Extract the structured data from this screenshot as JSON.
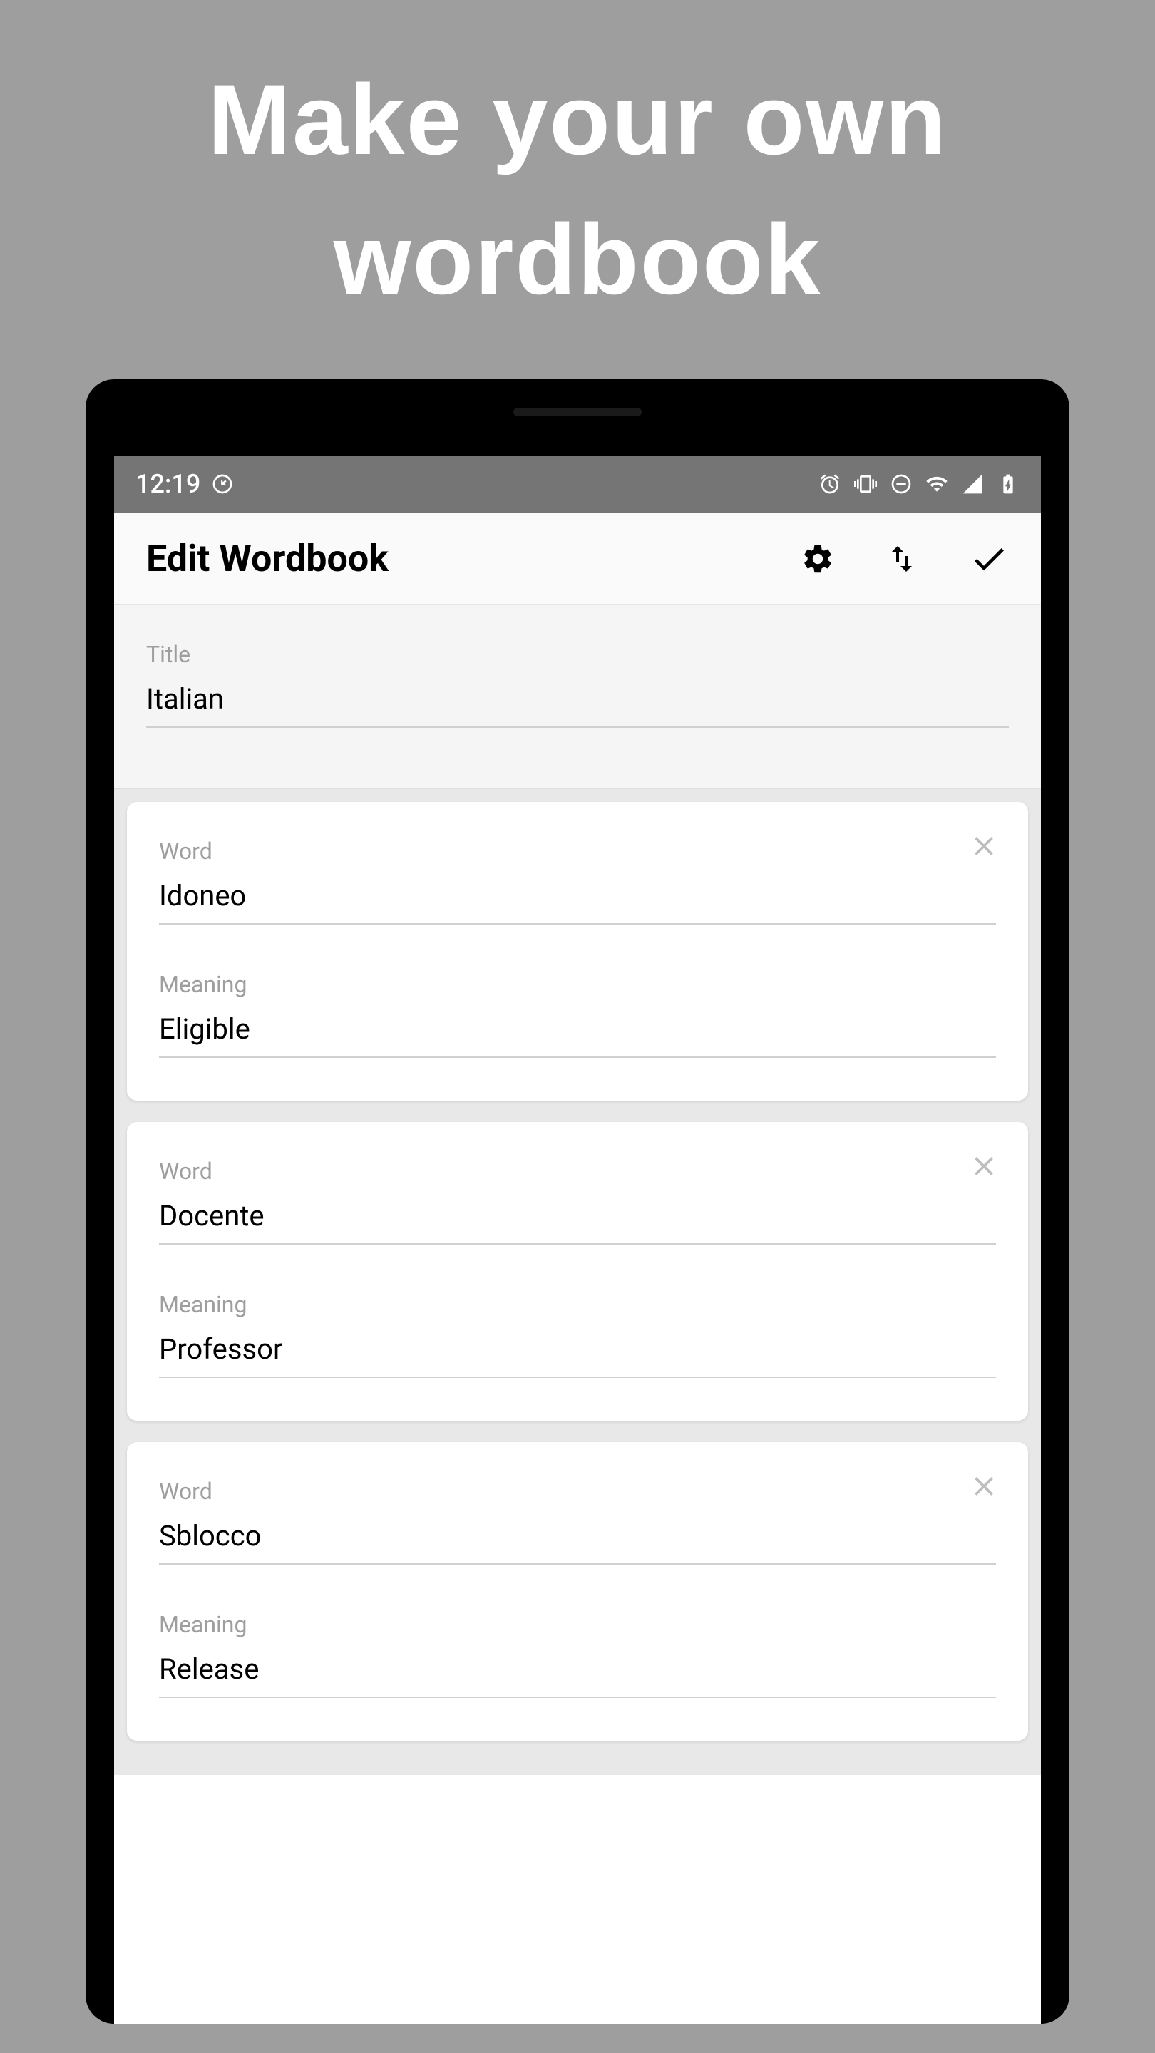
{
  "promo": {
    "title": "Make your own wordbook"
  },
  "statusBar": {
    "time": "12:19"
  },
  "appBar": {
    "title": "Edit Wordbook"
  },
  "titleField": {
    "label": "Title",
    "value": "Italian"
  },
  "labels": {
    "word": "Word",
    "meaning": "Meaning"
  },
  "cards": [
    {
      "word": "Idoneo",
      "meaning": "Eligible"
    },
    {
      "word": "Docente",
      "meaning": "Professor"
    },
    {
      "word": "Sblocco",
      "meaning": "Release"
    }
  ]
}
